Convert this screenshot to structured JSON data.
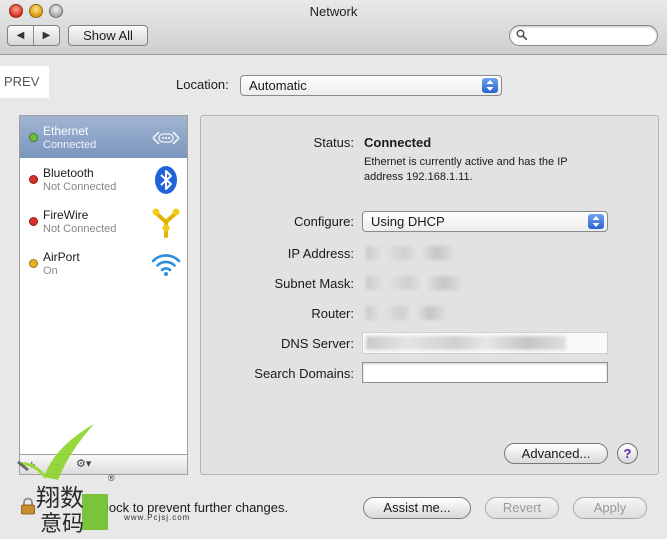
{
  "window": {
    "title": "Network"
  },
  "toolbar": {
    "back": "◀",
    "forward": "▶",
    "show_all": "Show All",
    "search_placeholder": ""
  },
  "prev_label": "PREV",
  "location": {
    "label": "Location:",
    "value": "Automatic"
  },
  "services": [
    {
      "name": "Ethernet",
      "status": "Connected",
      "dot": "#6cbf3a",
      "icon": "ethernet-icon",
      "selected": true
    },
    {
      "name": "Bluetooth",
      "status": "Not Connected",
      "dot": "#d9302a",
      "icon": "bluetooth-icon",
      "selected": false
    },
    {
      "name": "FireWire",
      "status": "Not Connected",
      "dot": "#d9302a",
      "icon": "firewire-icon",
      "selected": false
    },
    {
      "name": "AirPort",
      "status": "On",
      "dot": "#e8b21f",
      "icon": "airport-icon",
      "selected": false
    }
  ],
  "list_bar": {
    "add": "+",
    "remove": "−",
    "gear": "⚙▾"
  },
  "details": {
    "status_label": "Status:",
    "status_value": "Connected",
    "status_desc": "Ethernet is currently active and has the IP address 192.168.1.11.",
    "configure_label": "Configure:",
    "configure_value": "Using DHCP",
    "ip_label": "IP Address:",
    "subnet_label": "Subnet Mask:",
    "router_label": "Router:",
    "dns_label": "DNS Server:",
    "search_domains_label": "Search Domains:",
    "advanced": "Advanced...",
    "help": "?"
  },
  "footer": {
    "lock_text": "lock to prevent further changes.",
    "assist": "Assist me...",
    "revert": "Revert",
    "apply": "Apply"
  },
  "watermark": {
    "line1": "翔数",
    "line2": "意码",
    "reg": "®",
    "url": "www.Pcjsj.com"
  },
  "colors": {
    "selection": "#8aa2c6",
    "stepper": "#3a74dc"
  }
}
